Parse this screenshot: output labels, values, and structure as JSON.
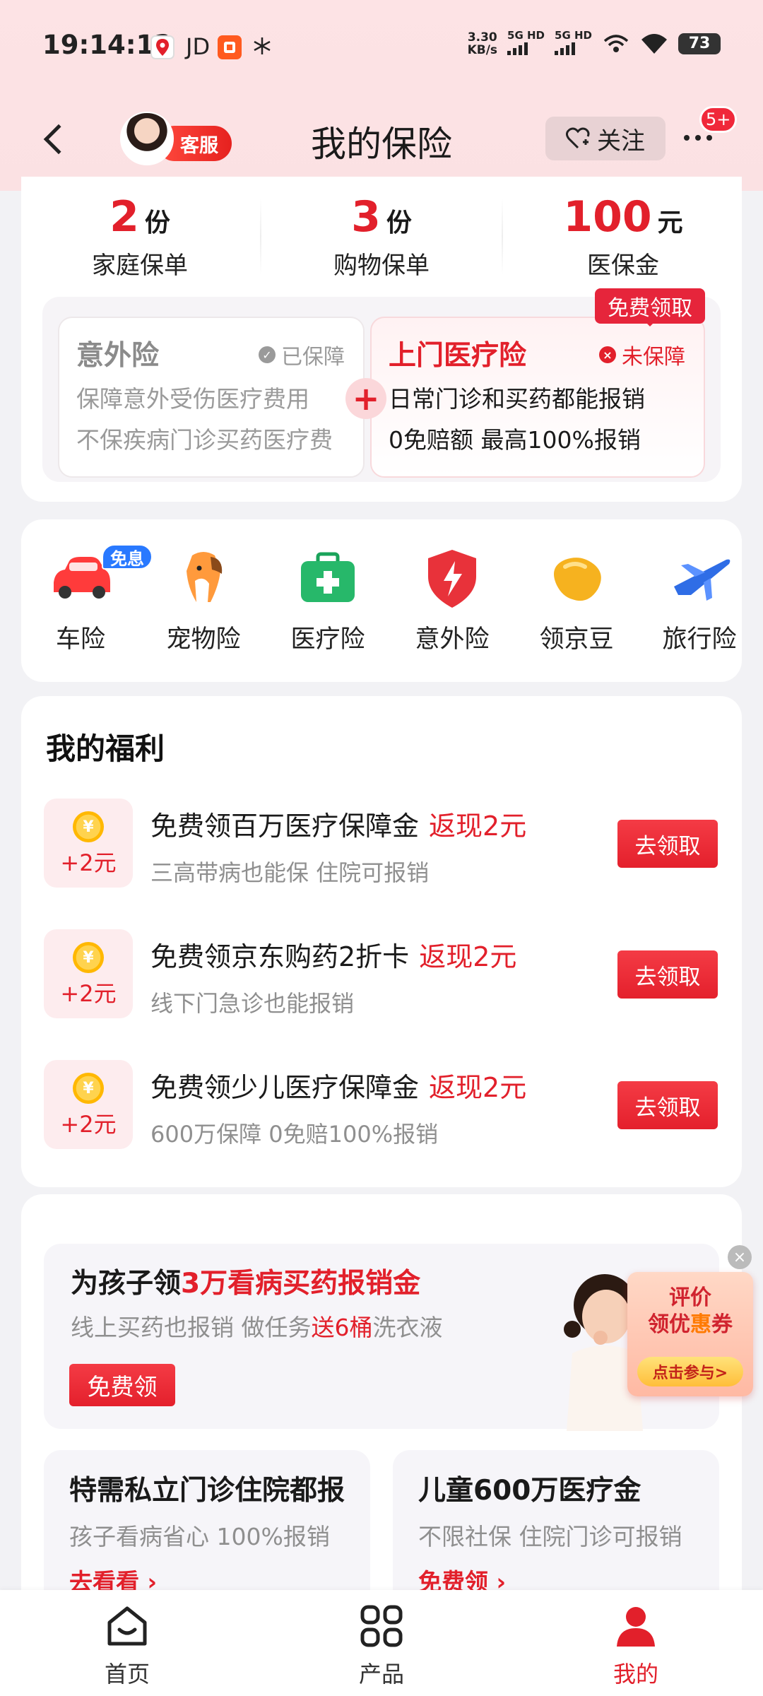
{
  "status_bar": {
    "time": "19:14:12",
    "jd": "JD",
    "net_speed": "3.30",
    "net_unit": "KB/s",
    "sig1": "5G HD",
    "sig2": "5G HD",
    "battery": "73"
  },
  "header": {
    "title": "我的保险",
    "customer_service": "客服",
    "follow": "关注",
    "more_badge": "5+"
  },
  "stats": [
    {
      "num": "2",
      "unit": "份",
      "label": "家庭保单"
    },
    {
      "num": "3",
      "unit": "份",
      "label": "购物保单"
    },
    {
      "num": "100",
      "unit": "元",
      "label": "医保金"
    }
  ],
  "plans": {
    "left": {
      "title": "意外险",
      "status": "已保障",
      "desc1": "保障意外受伤医疗费用",
      "desc2": "不保疾病门诊买药医疗费"
    },
    "right": {
      "title": "上门医疗险",
      "status": "未保障",
      "desc1": "日常门诊和买药都能报销",
      "desc2": "0免赔额 最高100%报销",
      "tag": "免费领取"
    }
  },
  "categories": [
    {
      "label": "车险",
      "icon": "car-icon",
      "badge": "免息"
    },
    {
      "label": "宠物险",
      "icon": "dog-icon"
    },
    {
      "label": "医疗险",
      "icon": "medical-kit-icon"
    },
    {
      "label": "意外险",
      "icon": "shield-icon"
    },
    {
      "label": "领京豆",
      "icon": "bean-icon"
    },
    {
      "label": "旅行险",
      "icon": "plane-icon"
    }
  ],
  "welfare": {
    "title": "我的福利",
    "coin_symbol": "¥",
    "items": [
      {
        "amount": "+2元",
        "title": "免费领百万医疗保障金",
        "cash": "返现2元",
        "sub": "三高带病也能保 住院可报销",
        "button": "去领取"
      },
      {
        "amount": "+2元",
        "title": "免费领京东购药2折卡",
        "cash": "返现2元",
        "sub": "线下门急诊也能报销",
        "button": "去领取"
      },
      {
        "amount": "+2元",
        "title": "免费领少儿医疗保障金",
        "cash": "返现2元",
        "sub": "600万保障 0免赔100%报销",
        "button": "去领取"
      }
    ]
  },
  "promo": {
    "big": {
      "title_a": "为孩子领",
      "title_b": "3万看病买药报销金",
      "sub_a": "线上买药也报销 做任务",
      "sub_b": "送6桶",
      "sub_c": "洗衣液",
      "button": "免费领"
    },
    "rate_tag": {
      "line1": "评价",
      "line2a": "领优",
      "line2b": "惠",
      "line2c": "券",
      "button": "点击参与>"
    },
    "small": [
      {
        "title": "特需私立门诊住院都报",
        "sub": "孩子看病省心 100%报销",
        "link": "去看看 ›"
      },
      {
        "title": "儿童600万医疗金",
        "sub": "不限社保 住院门诊可报销",
        "link": "免费领 ›"
      }
    ]
  },
  "bottom_nav": [
    {
      "label": "首页",
      "icon": "home-icon"
    },
    {
      "label": "产品",
      "icon": "grid-icon"
    },
    {
      "label": "我的",
      "icon": "profile-icon"
    }
  ],
  "colors": {
    "accent": "#e2202b",
    "header_bg": "#fde3e5",
    "page_bg": "#f2f2f5"
  }
}
